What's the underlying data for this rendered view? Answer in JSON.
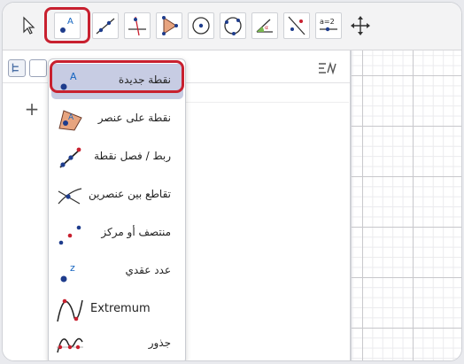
{
  "toolbar": {
    "tools": [
      {
        "name": "move-tool",
        "icon": "arrow-pointer-icon"
      },
      {
        "name": "point-tool",
        "icon": "point-a-icon",
        "selected": true
      },
      {
        "name": "line-tool",
        "icon": "line-icon"
      },
      {
        "name": "perpendicular-tool",
        "icon": "perpendicular-icon"
      },
      {
        "name": "polygon-tool",
        "icon": "polygon-icon"
      },
      {
        "name": "circle-center-tool",
        "icon": "circle-center-icon"
      },
      {
        "name": "circle-three-points-tool",
        "icon": "circle-points-icon"
      },
      {
        "name": "angle-tool",
        "icon": "angle-icon"
      },
      {
        "name": "reflect-tool",
        "icon": "reflect-icon"
      },
      {
        "name": "slider-tool",
        "icon": "slider-icon",
        "label": "a=2"
      },
      {
        "name": "move-graphics-tool",
        "icon": "move-arrows-icon"
      }
    ],
    "highlight_color": "#c8202f"
  },
  "menu": {
    "items": [
      {
        "label": "نقطة جديدة",
        "icon": "new-point-icon",
        "selected": true
      },
      {
        "label": "نقطة على عنصر",
        "icon": "point-on-object-icon"
      },
      {
        "label": "ربط / فصل نقطة",
        "icon": "attach-detach-icon"
      },
      {
        "label": "تقاطع بين عنصرين",
        "icon": "intersect-icon"
      },
      {
        "label": "منتصف أو مركز",
        "icon": "midpoint-icon"
      },
      {
        "label": "عدد عقدي",
        "icon": "complex-number-icon"
      },
      {
        "label": "Extremum",
        "icon": "extremum-icon"
      },
      {
        "label": "جذور",
        "icon": "roots-icon"
      }
    ]
  },
  "algebra": {
    "add_label": "+"
  },
  "colors": {
    "accent": "#1565c0",
    "point": "#1e3c8c",
    "selection": "#c7cce3"
  }
}
